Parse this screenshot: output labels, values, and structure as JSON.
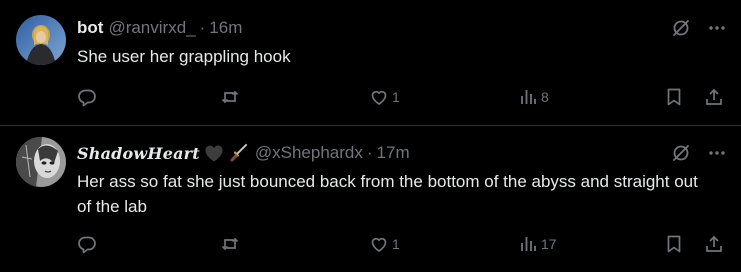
{
  "tweets": [
    {
      "display_name": "bot",
      "handle": "@ranvirxd_",
      "separator": "·",
      "time": "16m",
      "text": "She user her grappling hook",
      "likes": "1",
      "views": "8",
      "avatar_colors": [
        "#3b6fb0",
        "#c9a24a"
      ]
    },
    {
      "display_name": "ShadowHeart",
      "handle": "@xShephardx",
      "separator": "·",
      "time": "17m",
      "text": "Her ass so fat she just bounced back from the bottom of the abyss and straight out of the lab",
      "likes": "1",
      "views": "17",
      "avatar_colors": [
        "#8a8a8a",
        "#d8d8d8"
      ]
    }
  ],
  "icons": {
    "grok": "grok-icon",
    "more": "more-icon",
    "reply": "reply-icon",
    "repost": "repost-icon",
    "like": "heart-icon",
    "views": "views-icon",
    "bookmark": "bookmark-icon",
    "share": "share-icon",
    "emoji_heart": "black-heart-emoji",
    "emoji_dagger": "dagger-emoji"
  },
  "colors": {
    "background": "#000000",
    "text": "#e7e9ea",
    "muted": "#71767b",
    "divider": "#2f3336"
  }
}
